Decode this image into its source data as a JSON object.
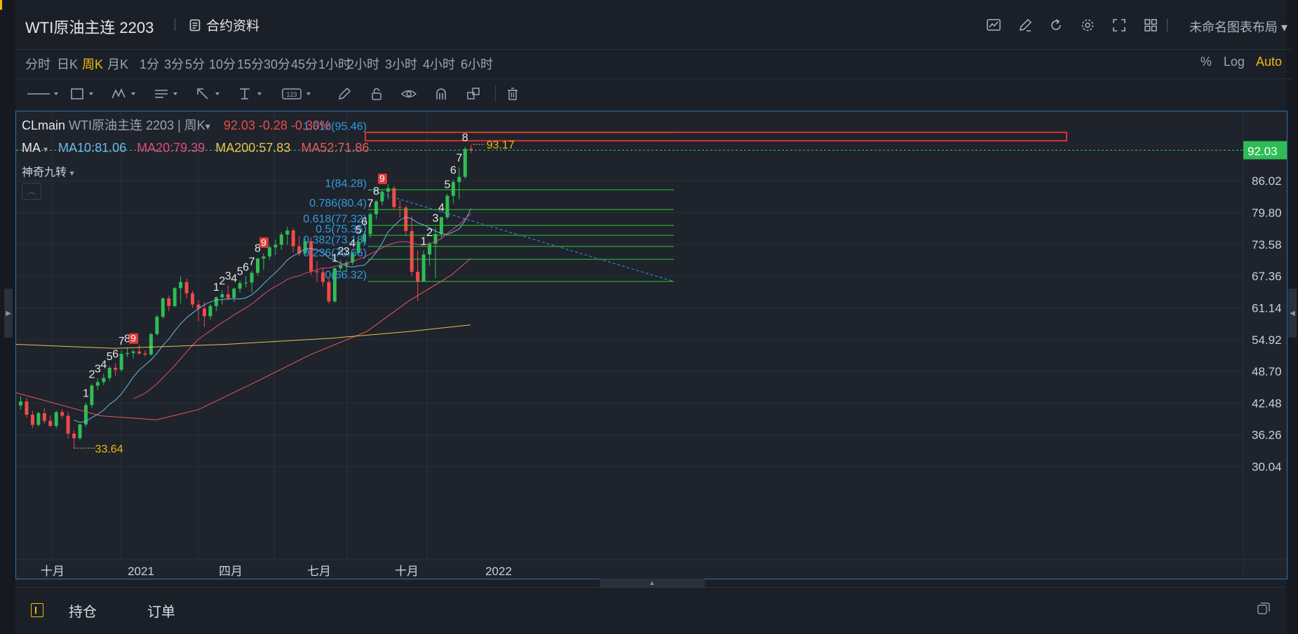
{
  "title": "WTI原油主连 2203",
  "contract_label": "合约资料",
  "layout_label": "未命名图表布局",
  "toolbar_icons": [
    "indicator-icon",
    "draw-icon",
    "refresh-icon",
    "gear-icon",
    "fullscreen-icon",
    "layout-grid-icon"
  ],
  "timeframes": [
    "分时",
    "日K",
    "周K",
    "月K",
    "1分",
    "3分",
    "5分",
    "10分",
    "15分",
    "30分",
    "45分",
    "1小时",
    "2小时",
    "3小时",
    "4小时",
    "6小时"
  ],
  "active_timeframe": "周K",
  "scale": {
    "percent": "%",
    "log": "Log",
    "auto": "Auto"
  },
  "draw_tools": [
    "line-icon",
    "rectangle-icon",
    "pattern-icon",
    "text-icon",
    "arrow-icon",
    "measure-icon",
    "number-label-icon",
    "pencil-icon",
    "lock-icon",
    "eye-icon",
    "magnet-icon",
    "clone-icon",
    "trash-icon"
  ],
  "legend": {
    "symbol": "CLmain",
    "name": "WTI原油主连 2203 | 周K",
    "quote": "92.03 -0.28 -0.30%",
    "ma_label": "MA",
    "ma10": "MA10:81.06",
    "ma20": "MA20:79.39",
    "ma200": "MA200:57.83",
    "ma52": "MA52:71.86",
    "indicator2": "神奇九转"
  },
  "colors": {
    "up": "#2ebd55",
    "down": "#f04a4a",
    "accent": "#f0b90b",
    "ma10": "#6fb6e8",
    "ma20": "#e24a7a",
    "ma200": "#e6c34a",
    "ma52": "#e85a5a",
    "fib": "#2f9bdc",
    "fibline": "#32c832"
  },
  "price_axis": [
    "86.02",
    "79.80",
    "73.58",
    "67.36",
    "61.14",
    "54.92",
    "48.70",
    "42.48",
    "36.26",
    "30.04"
  ],
  "current_price": "92.03",
  "time_axis": [
    "十月",
    "2021",
    "四月",
    "七月",
    "十月",
    "2022"
  ],
  "fib_levels": [
    "1.618(95.46)",
    "1(84.28)",
    "0.786(80.4)",
    "0.618(77.32)",
    "0.5(75.35)",
    "0.382(73.18)",
    "0.236(70.66)",
    "0(66.32)"
  ],
  "price_labels": {
    "high": "93.17",
    "low": "33.64"
  },
  "td_counts_a": [
    "1",
    "2",
    "3",
    "4",
    "5",
    "6",
    "7",
    "8",
    "9"
  ],
  "td_counts_b": [
    "1",
    "2",
    "3",
    "4",
    "5",
    "6",
    "7",
    "8",
    "9"
  ],
  "td_counts_c": [
    "1",
    "2",
    "3",
    "4",
    "5",
    "6",
    "7",
    "8",
    "9"
  ],
  "td_counts_d": [
    "1",
    "2",
    "3",
    "4",
    "5",
    "6",
    "7",
    "8"
  ],
  "bottom_tabs": [
    "持仓",
    "订单"
  ]
}
